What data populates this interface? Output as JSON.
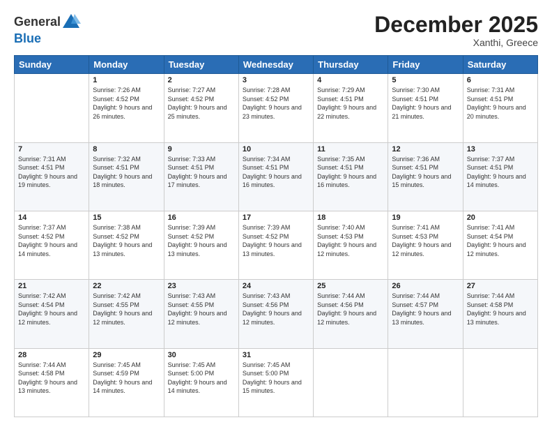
{
  "header": {
    "logo_line1": "General",
    "logo_line2": "Blue",
    "month": "December 2025",
    "location": "Xanthi, Greece"
  },
  "weekdays": [
    "Sunday",
    "Monday",
    "Tuesday",
    "Wednesday",
    "Thursday",
    "Friday",
    "Saturday"
  ],
  "weeks": [
    [
      {
        "day": "",
        "sunrise": "",
        "sunset": "",
        "daylight": ""
      },
      {
        "day": "1",
        "sunrise": "7:26 AM",
        "sunset": "4:52 PM",
        "daylight": "9 hours and 26 minutes."
      },
      {
        "day": "2",
        "sunrise": "7:27 AM",
        "sunset": "4:52 PM",
        "daylight": "9 hours and 25 minutes."
      },
      {
        "day": "3",
        "sunrise": "7:28 AM",
        "sunset": "4:52 PM",
        "daylight": "9 hours and 23 minutes."
      },
      {
        "day": "4",
        "sunrise": "7:29 AM",
        "sunset": "4:51 PM",
        "daylight": "9 hours and 22 minutes."
      },
      {
        "day": "5",
        "sunrise": "7:30 AM",
        "sunset": "4:51 PM",
        "daylight": "9 hours and 21 minutes."
      },
      {
        "day": "6",
        "sunrise": "7:31 AM",
        "sunset": "4:51 PM",
        "daylight": "9 hours and 20 minutes."
      }
    ],
    [
      {
        "day": "7",
        "sunrise": "7:31 AM",
        "sunset": "4:51 PM",
        "daylight": "9 hours and 19 minutes."
      },
      {
        "day": "8",
        "sunrise": "7:32 AM",
        "sunset": "4:51 PM",
        "daylight": "9 hours and 18 minutes."
      },
      {
        "day": "9",
        "sunrise": "7:33 AM",
        "sunset": "4:51 PM",
        "daylight": "9 hours and 17 minutes."
      },
      {
        "day": "10",
        "sunrise": "7:34 AM",
        "sunset": "4:51 PM",
        "daylight": "9 hours and 16 minutes."
      },
      {
        "day": "11",
        "sunrise": "7:35 AM",
        "sunset": "4:51 PM",
        "daylight": "9 hours and 16 minutes."
      },
      {
        "day": "12",
        "sunrise": "7:36 AM",
        "sunset": "4:51 PM",
        "daylight": "9 hours and 15 minutes."
      },
      {
        "day": "13",
        "sunrise": "7:37 AM",
        "sunset": "4:51 PM",
        "daylight": "9 hours and 14 minutes."
      }
    ],
    [
      {
        "day": "14",
        "sunrise": "7:37 AM",
        "sunset": "4:52 PM",
        "daylight": "9 hours and 14 minutes."
      },
      {
        "day": "15",
        "sunrise": "7:38 AM",
        "sunset": "4:52 PM",
        "daylight": "9 hours and 13 minutes."
      },
      {
        "day": "16",
        "sunrise": "7:39 AM",
        "sunset": "4:52 PM",
        "daylight": "9 hours and 13 minutes."
      },
      {
        "day": "17",
        "sunrise": "7:39 AM",
        "sunset": "4:52 PM",
        "daylight": "9 hours and 13 minutes."
      },
      {
        "day": "18",
        "sunrise": "7:40 AM",
        "sunset": "4:53 PM",
        "daylight": "9 hours and 12 minutes."
      },
      {
        "day": "19",
        "sunrise": "7:41 AM",
        "sunset": "4:53 PM",
        "daylight": "9 hours and 12 minutes."
      },
      {
        "day": "20",
        "sunrise": "7:41 AM",
        "sunset": "4:54 PM",
        "daylight": "9 hours and 12 minutes."
      }
    ],
    [
      {
        "day": "21",
        "sunrise": "7:42 AM",
        "sunset": "4:54 PM",
        "daylight": "9 hours and 12 minutes."
      },
      {
        "day": "22",
        "sunrise": "7:42 AM",
        "sunset": "4:55 PM",
        "daylight": "9 hours and 12 minutes."
      },
      {
        "day": "23",
        "sunrise": "7:43 AM",
        "sunset": "4:55 PM",
        "daylight": "9 hours and 12 minutes."
      },
      {
        "day": "24",
        "sunrise": "7:43 AM",
        "sunset": "4:56 PM",
        "daylight": "9 hours and 12 minutes."
      },
      {
        "day": "25",
        "sunrise": "7:44 AM",
        "sunset": "4:56 PM",
        "daylight": "9 hours and 12 minutes."
      },
      {
        "day": "26",
        "sunrise": "7:44 AM",
        "sunset": "4:57 PM",
        "daylight": "9 hours and 13 minutes."
      },
      {
        "day": "27",
        "sunrise": "7:44 AM",
        "sunset": "4:58 PM",
        "daylight": "9 hours and 13 minutes."
      }
    ],
    [
      {
        "day": "28",
        "sunrise": "7:44 AM",
        "sunset": "4:58 PM",
        "daylight": "9 hours and 13 minutes."
      },
      {
        "day": "29",
        "sunrise": "7:45 AM",
        "sunset": "4:59 PM",
        "daylight": "9 hours and 14 minutes."
      },
      {
        "day": "30",
        "sunrise": "7:45 AM",
        "sunset": "5:00 PM",
        "daylight": "9 hours and 14 minutes."
      },
      {
        "day": "31",
        "sunrise": "7:45 AM",
        "sunset": "5:00 PM",
        "daylight": "9 hours and 15 minutes."
      },
      {
        "day": "",
        "sunrise": "",
        "sunset": "",
        "daylight": ""
      },
      {
        "day": "",
        "sunrise": "",
        "sunset": "",
        "daylight": ""
      },
      {
        "day": "",
        "sunrise": "",
        "sunset": "",
        "daylight": ""
      }
    ]
  ],
  "labels": {
    "sunrise": "Sunrise:",
    "sunset": "Sunset:",
    "daylight": "Daylight:"
  }
}
